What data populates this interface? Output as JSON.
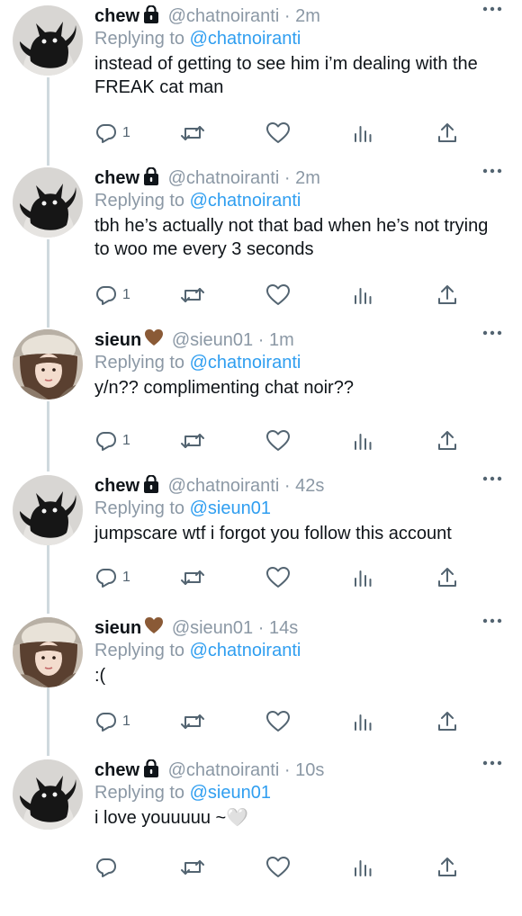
{
  "tweets": [
    {
      "name": "chew",
      "badge": "lock",
      "handle": "@chatnoiranti",
      "time": "2m",
      "reply_prefix": "Replying to",
      "reply_to": "@chatnoiranti",
      "text": "instead of getting to see him i’m dealing with the FREAK cat man",
      "reply_count": "1"
    },
    {
      "name": "chew",
      "badge": "lock",
      "handle": "@chatnoiranti",
      "time": "2m",
      "reply_prefix": "Replying to",
      "reply_to": "@chatnoiranti",
      "text": "tbh he’s actually not that bad when he’s not trying to woo me every 3 seconds",
      "reply_count": "1"
    },
    {
      "name": "sieun",
      "badge": "brown-heart",
      "handle": "@sieun01",
      "time": "1m",
      "reply_prefix": "Replying to",
      "reply_to": "@chatnoiranti",
      "text": "y/n?? complimenting chat noir??",
      "reply_count": "1"
    },
    {
      "name": "chew",
      "badge": "lock",
      "handle": "@chatnoiranti",
      "time": "42s",
      "reply_prefix": "Replying to",
      "reply_to": "@sieun01",
      "text": "jumpscare wtf i forgot you follow this account",
      "reply_count": "1"
    },
    {
      "name": "sieun",
      "badge": "brown-heart",
      "handle": "@sieun01",
      "time": "14s",
      "reply_prefix": "Replying to",
      "reply_to": "@chatnoiranti",
      "text": ":(",
      "reply_count": "1"
    },
    {
      "name": "chew",
      "badge": "lock",
      "handle": "@chatnoiranti",
      "time": "10s",
      "reply_prefix": "Replying to",
      "reply_to": "@sieun01",
      "text": "i love youuuuu ~🤍",
      "reply_count": ""
    }
  ],
  "separator": "·",
  "icons": {
    "reply": "reply-icon",
    "retweet": "retweet-icon",
    "like": "heart-icon",
    "views": "views-icon",
    "share": "share-icon",
    "more": "more-icon"
  },
  "colors": {
    "mention": "#2f9ef0",
    "muted": "#8b98a5",
    "icon": "#536471",
    "thread_line": "#cfd9de",
    "brown_heart": "#8a5a36"
  }
}
